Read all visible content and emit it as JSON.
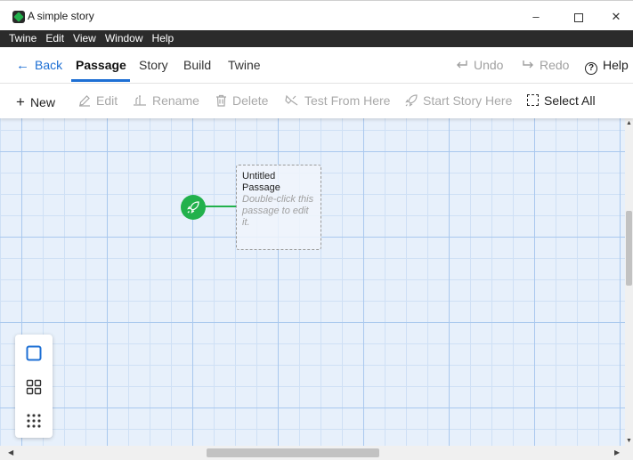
{
  "window": {
    "title": "A simple story",
    "minimize_glyph": "–",
    "close_glyph": "✕"
  },
  "menubar": [
    "Twine",
    "Edit",
    "View",
    "Window",
    "Help"
  ],
  "topnav": {
    "back": "Back",
    "tabs": [
      "Passage",
      "Story",
      "Build",
      "Twine"
    ],
    "active_tab": "Passage",
    "undo": "Undo",
    "redo": "Redo",
    "help": "Help"
  },
  "toolbar": {
    "new": "New",
    "edit": "Edit",
    "rename": "Rename",
    "delete": "Delete",
    "test_from_here": "Test From Here",
    "start_story_here": "Start Story Here",
    "select_all": "Select All"
  },
  "canvas": {
    "passage": {
      "title": "Untitled Passage",
      "excerpt": "Double-click this passage to edit it."
    }
  },
  "icons": {
    "app": "twine-logo-icon",
    "back": "arrow-left-icon",
    "undo": "undo-icon",
    "redo": "redo-icon",
    "help": "question-circle-icon",
    "new": "plus-icon",
    "edit": "pencil-icon",
    "rename": "rename-icon",
    "delete": "trash-icon",
    "test": "test-icon",
    "start": "rocket-icon",
    "select_all": "dashed-square-icon",
    "zoom_1": "square-icon",
    "zoom_2": "grid-2x2-icon",
    "zoom_3": "grid-3x3-dots-icon"
  },
  "colors": {
    "accent": "#1d6fd4",
    "start": "#22b14c",
    "menubar": "#2b2b2b",
    "canvas": "#e7f0fb"
  }
}
